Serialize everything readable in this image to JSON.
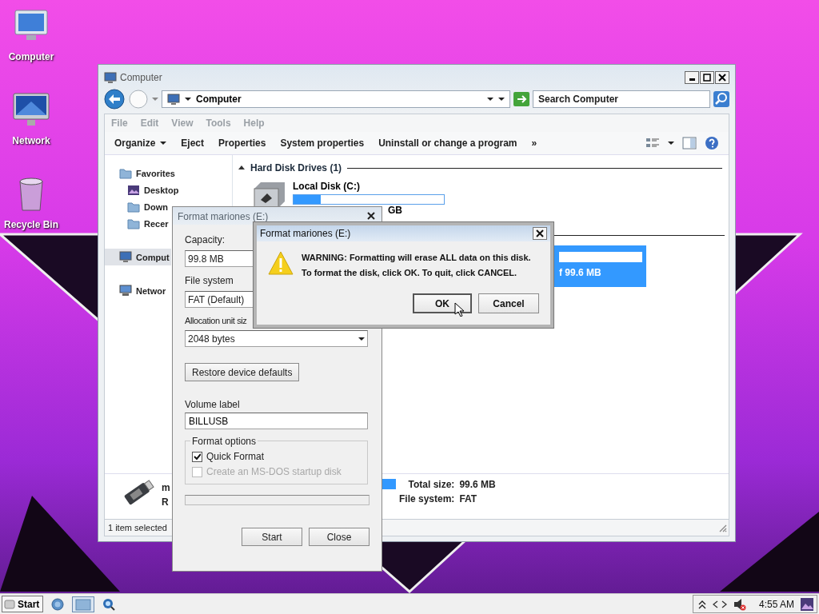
{
  "desktop_icons": [
    {
      "label": "Computer",
      "kind": "computer"
    },
    {
      "label": "Network",
      "kind": "network"
    },
    {
      "label": "Recycle Bin",
      "kind": "recycle"
    }
  ],
  "explorer": {
    "title": "Computer",
    "address": "Computer",
    "search": {
      "placeholder": "Search Computer"
    },
    "menu": [
      "File",
      "Edit",
      "View",
      "Tools",
      "Help"
    ],
    "toolbar": [
      {
        "label": "Organize",
        "dropdown": true
      },
      {
        "label": "Eject",
        "dropdown": false
      },
      {
        "label": "Properties",
        "dropdown": false
      },
      {
        "label": "System properties",
        "dropdown": false
      },
      {
        "label": "Uninstall or change a program",
        "dropdown": false
      }
    ],
    "toolbar_more": "»",
    "sidebar": [
      {
        "label": "Favorites",
        "kind": "folder",
        "selected": false,
        "children": [
          {
            "label": "Desktop",
            "kind": "desktop",
            "selected": false
          },
          {
            "label": "Down",
            "kind": "folder",
            "selected": false
          },
          {
            "label": "Recer",
            "kind": "folder",
            "selected": false
          }
        ]
      },
      {
        "label": "Comput",
        "kind": "computer",
        "selected": true
      },
      {
        "label": "Networ",
        "kind": "network",
        "selected": false
      }
    ],
    "group": {
      "label": "Hard Disk Drives (1)",
      "expanded": true
    },
    "drives": [
      {
        "name": "Local Disk (C:)",
        "level": 0.18,
        "size_text": "GB",
        "selected": false
      },
      {
        "size_text": "f 99.6 MB",
        "level": 0,
        "selected": true
      }
    ],
    "details": {
      "name": "m",
      "line_2": "R",
      "level": 1,
      "total_size_label": "Total size:",
      "total_size": "99.6 MB",
      "fs_label": "File system:",
      "fs": "FAT"
    },
    "status": "1 item selected"
  },
  "format_dialog": {
    "title": "Format mariones (E:)",
    "capacity_label": "Capacity:",
    "capacity": "99.8 MB",
    "fs_label": "File system",
    "fs": "FAT (Default)",
    "alloc_label": "Allocation unit siz",
    "alloc": "2048 bytes",
    "restore": "Restore device defaults",
    "volume_label_label": "Volume label",
    "volume_label": "BILLUSB",
    "options_title": "Format options",
    "options": [
      {
        "label": "Quick Format",
        "checked": true,
        "disabled": false
      },
      {
        "label": "Create an MS-DOS startup disk",
        "checked": false,
        "disabled": true
      }
    ],
    "progress": {
      "level": 0
    },
    "buttons": [
      "Start",
      "Close"
    ]
  },
  "message": {
    "title": "Format mariones (E:)",
    "lines": [
      "WARNING: Formatting will erase ALL data on this disk.",
      "To format the disk, click OK. To quit, click CANCEL."
    ],
    "buttons": [
      {
        "label": "OK",
        "default": true
      },
      {
        "label": "Cancel",
        "default": false
      }
    ]
  },
  "taskbar": {
    "start": "Start",
    "time": "4:55 AM"
  }
}
